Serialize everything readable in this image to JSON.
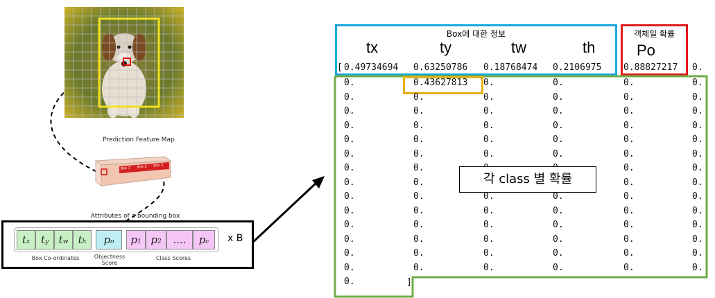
{
  "feature_map": {
    "title": "Prediction Feature Map",
    "box_labels": [
      "Box 1",
      "Box 2",
      "Box 3"
    ]
  },
  "attributes": {
    "title": "Attributes of a bounding box",
    "cells": [
      "t",
      "t",
      "t",
      "t",
      "p",
      "p",
      "p",
      "....",
      "p"
    ],
    "subs": [
      "x",
      "y",
      "w",
      "h",
      "o",
      "1",
      "2",
      "",
      "c"
    ],
    "box_coordinates": "Box Co-ordinates",
    "objectness_line1": "Objectness",
    "objectness_line2": "Score",
    "class_scores": "Class Scores",
    "multiplier": "x B"
  },
  "box_info": {
    "title": "Box에 대한 정보",
    "headers": [
      "tx",
      "ty",
      "tw",
      "th"
    ]
  },
  "objectness_info": {
    "title": "객체일 확률",
    "header": "Po"
  },
  "first_row": {
    "open_bracket": "[",
    "values": [
      "0.49734694",
      "0.63250786",
      "0.18768474",
      "0.2106975",
      "0.88827217",
      "0."
    ]
  },
  "highlight_value": "0.43627813",
  "zero_value": "0.",
  "close_bracket": "]",
  "class_prob_label": "각 class 별 확률",
  "colors": {
    "box_info_border": "#1aa7e0",
    "objectness_border": "#e0191e",
    "class_border": "#70ad47",
    "highlight_border": "#e8b214",
    "attribute_box_border": "#000000"
  }
}
